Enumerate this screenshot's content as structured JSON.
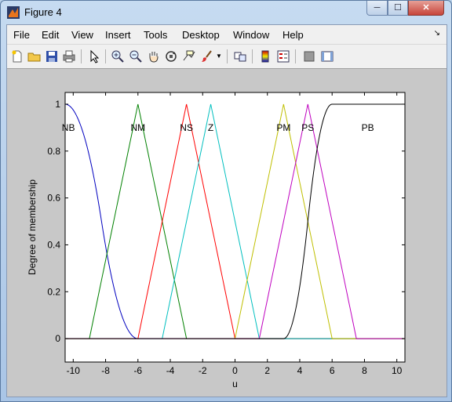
{
  "window": {
    "title": "Figure 4"
  },
  "controls": {
    "minimize": "─",
    "maximize": "☐",
    "close": "✕"
  },
  "menu": [
    "File",
    "Edit",
    "View",
    "Insert",
    "Tools",
    "Desktop",
    "Window",
    "Help"
  ],
  "toolbar_icons": [
    "new-figure-icon",
    "open-file-icon",
    "save-icon",
    "print-icon",
    "pointer-icon",
    "zoom-in-icon",
    "zoom-out-icon",
    "pan-hand-icon",
    "rotate-3d-icon",
    "data-cursor-icon",
    "brush-icon",
    "brush-dropdown-icon",
    "link-plot-icon",
    "colorbar-icon",
    "legend-icon",
    "hide-plot-tools-icon",
    "show-plot-tools-icon"
  ],
  "chart_data": {
    "type": "line",
    "title": "",
    "xlabel": "u",
    "ylabel": "Degree of membership",
    "xlim": [
      -10.5,
      10.5
    ],
    "ylim": [
      -0.1,
      1.05
    ],
    "xticks": [
      -10,
      -8,
      -6,
      -4,
      -2,
      0,
      2,
      4,
      6,
      8,
      10
    ],
    "yticks": [
      0,
      0.2,
      0.4,
      0.6,
      0.8,
      1
    ],
    "grid": false,
    "series": [
      {
        "name": "NB",
        "color": "#0000bf",
        "label_x": -10.3,
        "shape": "zmf",
        "params": [
          -10.5,
          -6
        ]
      },
      {
        "name": "NM",
        "color": "#008000",
        "label_x": -6,
        "shape": "gtri",
        "params": [
          -9,
          -6,
          -3
        ]
      },
      {
        "name": "NS",
        "color": "#ff0000",
        "label_x": -3,
        "shape": "gtri",
        "params": [
          -6,
          -3,
          0
        ]
      },
      {
        "name": "Z",
        "color": "#00bfbf",
        "label_x": -1.5,
        "shape": "gtri",
        "params": [
          -4.5,
          -1.5,
          1.5
        ]
      },
      {
        "name": "PM",
        "color": "#bfbf00",
        "label_x": 3,
        "shape": "gtri",
        "params": [
          0,
          3,
          6
        ]
      },
      {
        "name": "PS",
        "color": "#bf00bf",
        "label_x": 4.5,
        "shape": "gtri",
        "params": [
          1.5,
          4.5,
          7.5
        ]
      },
      {
        "name": "PB",
        "color": "#000000",
        "label_x": 8.2,
        "shape": "smf",
        "params": [
          3,
          6
        ]
      }
    ]
  }
}
